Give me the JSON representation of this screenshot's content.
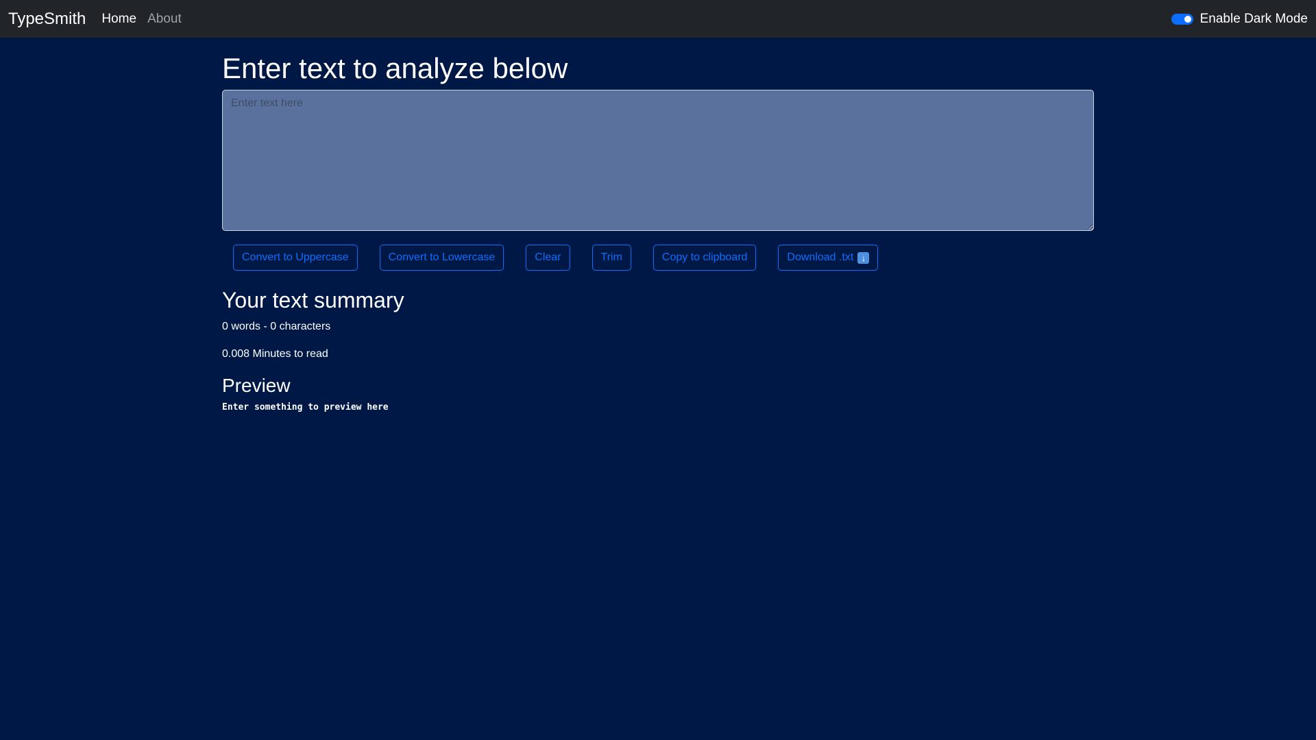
{
  "navbar": {
    "brand": "TypeSmith",
    "links": [
      {
        "label": "Home",
        "active": true
      },
      {
        "label": "About",
        "active": false
      }
    ],
    "dark_mode_toggle": {
      "label": "Enable Dark Mode",
      "checked": true
    }
  },
  "main": {
    "heading": "Enter text to analyze below",
    "textarea": {
      "value": "",
      "placeholder": "Enter text here"
    },
    "buttons": {
      "uppercase": "Convert to Uppercase",
      "lowercase": "Convert to Lowercase",
      "clear": "Clear",
      "trim": "Trim",
      "copy": "Copy to clipboard",
      "download": "Download .txt",
      "download_icon": "down-arrow-icon"
    },
    "summary": {
      "heading": "Your text summary",
      "counts": "0 words - 0 characters",
      "read_time": "0.008 Minutes to read"
    },
    "preview": {
      "heading": "Preview",
      "text": "Enter something to preview here"
    }
  },
  "colors": {
    "background": "#001845",
    "navbar": "#212529",
    "accent": "#0d6efd",
    "textarea_bg": "#5a719e"
  }
}
